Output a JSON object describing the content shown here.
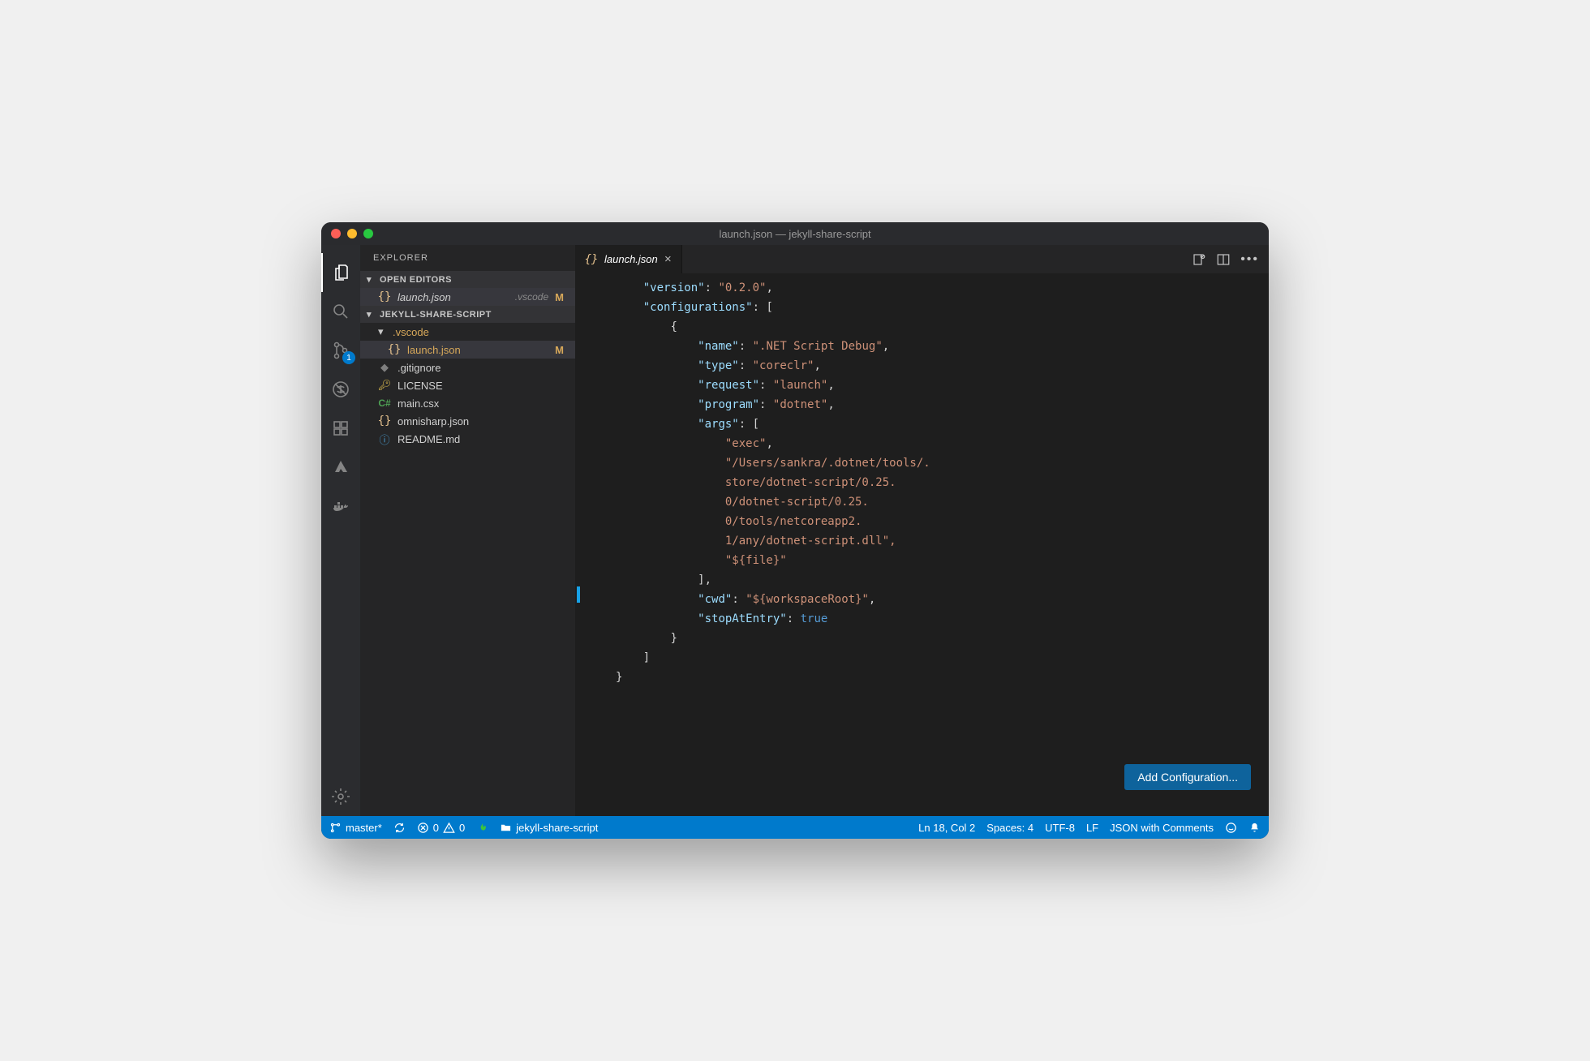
{
  "titlebar": {
    "title": "launch.json — jekyll-share-script"
  },
  "activitybar": {
    "badge_scm": "1",
    "items": [
      "files",
      "search",
      "scm",
      "debug",
      "extensions",
      "azure",
      "docker"
    ],
    "settings": "settings"
  },
  "sidebar": {
    "title": "EXPLORER",
    "open_editors_label": "OPEN EDITORS",
    "open_editors": [
      {
        "icon": "braces",
        "name": "launch.json",
        "hint": ".vscode",
        "git": "M"
      }
    ],
    "workspace_label": "JEKYLL-SHARE-SCRIPT",
    "tree": {
      "folder": {
        "name": ".vscode",
        "modified": true,
        "children": [
          {
            "icon": "braces",
            "name": "launch.json",
            "git": "M"
          }
        ]
      },
      "files": [
        {
          "icon": "git",
          "name": ".gitignore"
        },
        {
          "icon": "key",
          "name": "LICENSE"
        },
        {
          "icon": "csharp",
          "name": "main.csx"
        },
        {
          "icon": "braces",
          "name": "omnisharp.json"
        },
        {
          "icon": "info",
          "name": "README.md"
        }
      ]
    }
  },
  "tabbar": {
    "tab": {
      "icon": "braces",
      "name": "launch.json"
    }
  },
  "editor": {
    "lines": [
      {
        "i": 0,
        "t": "    \"version\": \"0.2.0\","
      },
      {
        "i": 0,
        "t": "    \"configurations\": ["
      },
      {
        "i": 0,
        "t": "        {"
      },
      {
        "i": 0,
        "t": "            \"name\": \".NET Script Debug\","
      },
      {
        "i": 0,
        "t": "            \"type\": \"coreclr\","
      },
      {
        "i": 0,
        "t": "            \"request\": \"launch\","
      },
      {
        "i": 0,
        "t": "            \"program\": \"dotnet\","
      },
      {
        "i": 0,
        "t": "            \"args\": ["
      },
      {
        "i": 0,
        "t": "                \"exec\","
      },
      {
        "i": 0,
        "t": "                \"/Users/sankra/.dotnet/tools/."
      },
      {
        "i": 0,
        "t": "                store/dotnet-script/0.25."
      },
      {
        "i": 0,
        "t": "                0/dotnet-script/0.25."
      },
      {
        "i": 0,
        "t": "                0/tools/netcoreapp2."
      },
      {
        "i": 0,
        "t": "                1/any/dotnet-script.dll\","
      },
      {
        "i": 0,
        "t": "                \"${file}\""
      },
      {
        "i": 0,
        "t": "            ],"
      },
      {
        "i": 0,
        "t": "            \"cwd\": \"${workspaceRoot}\","
      },
      {
        "i": 0,
        "t": "            \"stopAtEntry\": true"
      },
      {
        "i": 0,
        "t": "        }"
      },
      {
        "i": 0,
        "t": "    ]"
      },
      {
        "i": 0,
        "t": "}"
      }
    ]
  },
  "add_config_button": "Add Configuration...",
  "statusbar": {
    "branch": "master*",
    "errors": "0",
    "warnings": "0",
    "folder": "jekyll-share-script",
    "position": "Ln 18, Col 2",
    "spaces": "Spaces: 4",
    "encoding": "UTF-8",
    "eol": "LF",
    "language": "JSON with Comments"
  }
}
